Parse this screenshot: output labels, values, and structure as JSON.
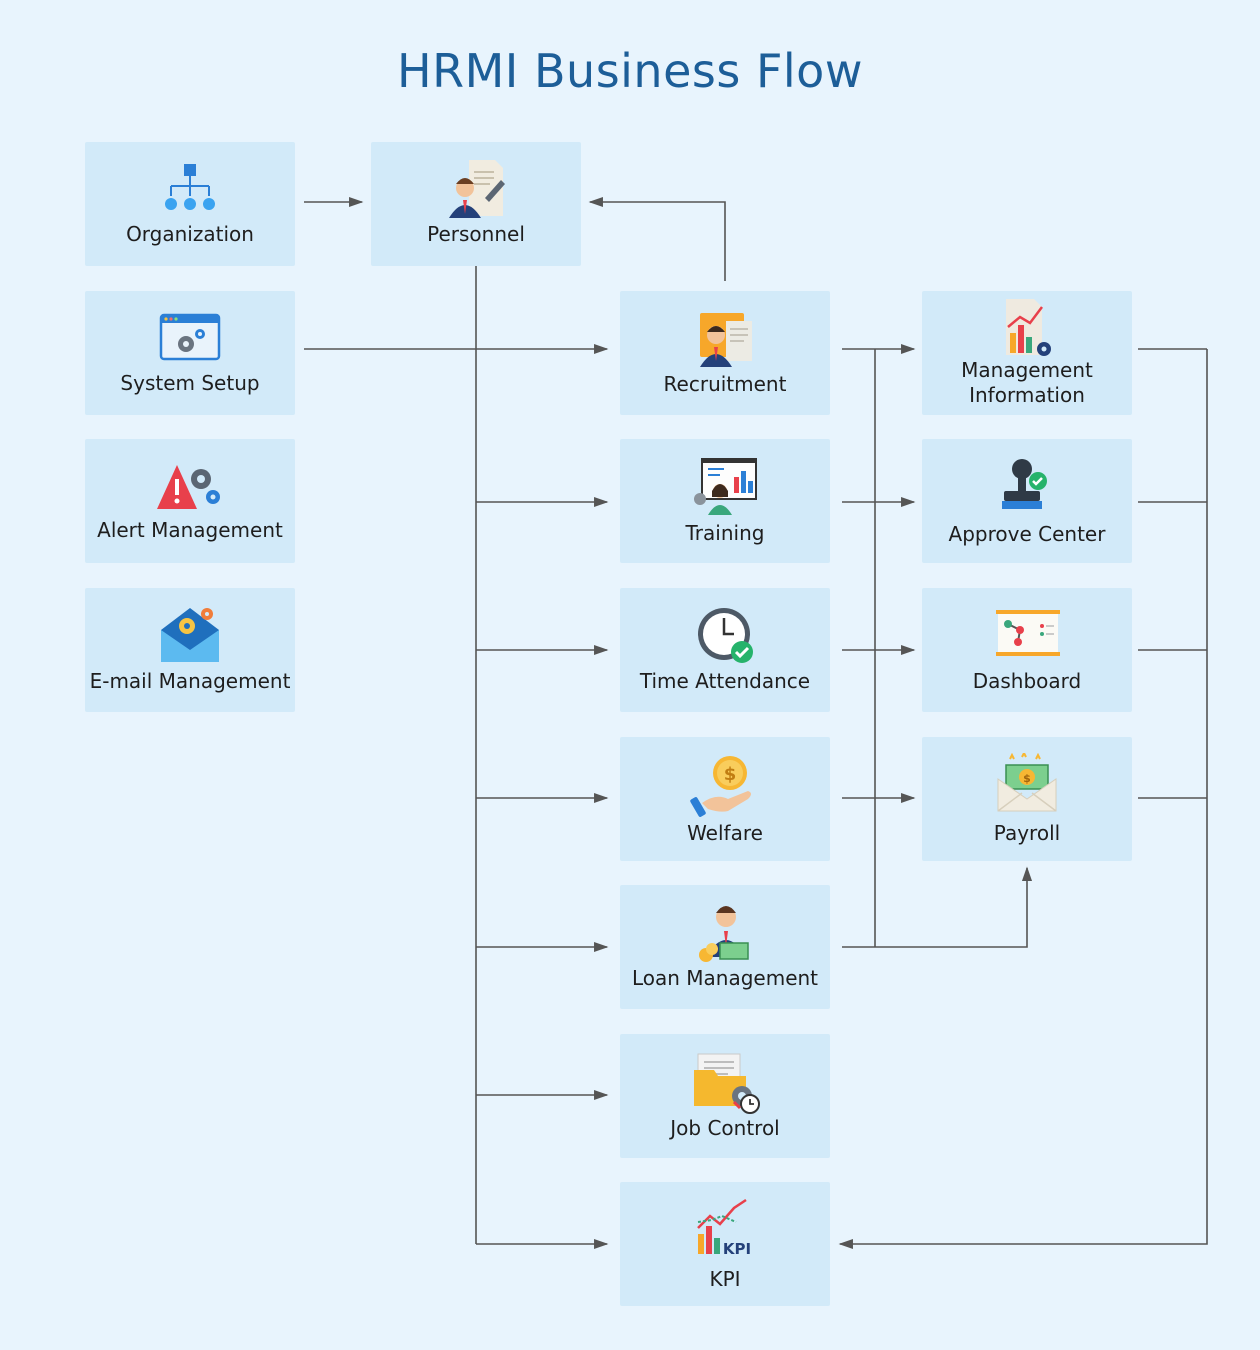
{
  "title": "HRMI Business Flow",
  "nodes": {
    "organization": "Organization",
    "personnel": "Personnel",
    "system_setup": "System Setup",
    "alert_management": "Alert Management",
    "email_management": "E-mail Management",
    "recruitment": "Recruitment",
    "training": "Training",
    "time_attendance": "Time Attendance",
    "welfare": "Welfare",
    "loan_management": "Loan Management",
    "job_control": "Job Control",
    "kpi": "KPI",
    "management_information_line1": "Management",
    "management_information_line2": "Information",
    "approve_center": "Approve Center",
    "dashboard": "Dashboard",
    "payroll": "Payroll"
  },
  "icons": {
    "organization": "org-chart-icon",
    "personnel": "employee-document-icon",
    "system_setup": "settings-window-icon",
    "alert_management": "alert-gear-icon",
    "email_management": "email-gear-icon",
    "recruitment": "recruiter-icon",
    "training": "training-board-icon",
    "time_attendance": "clock-check-icon",
    "welfare": "hand-coin-icon",
    "loan_management": "person-money-icon",
    "job_control": "folder-gear-icon",
    "kpi": "kpi-chart-icon",
    "management_information": "report-chart-icon",
    "approve_center": "stamp-check-icon",
    "dashboard": "dashboard-board-icon",
    "payroll": "salary-envelope-icon"
  },
  "colors": {
    "background": "#e8f4fd",
    "box": "#d2eaf9",
    "title": "#1d5e98",
    "connector": "#555555"
  }
}
